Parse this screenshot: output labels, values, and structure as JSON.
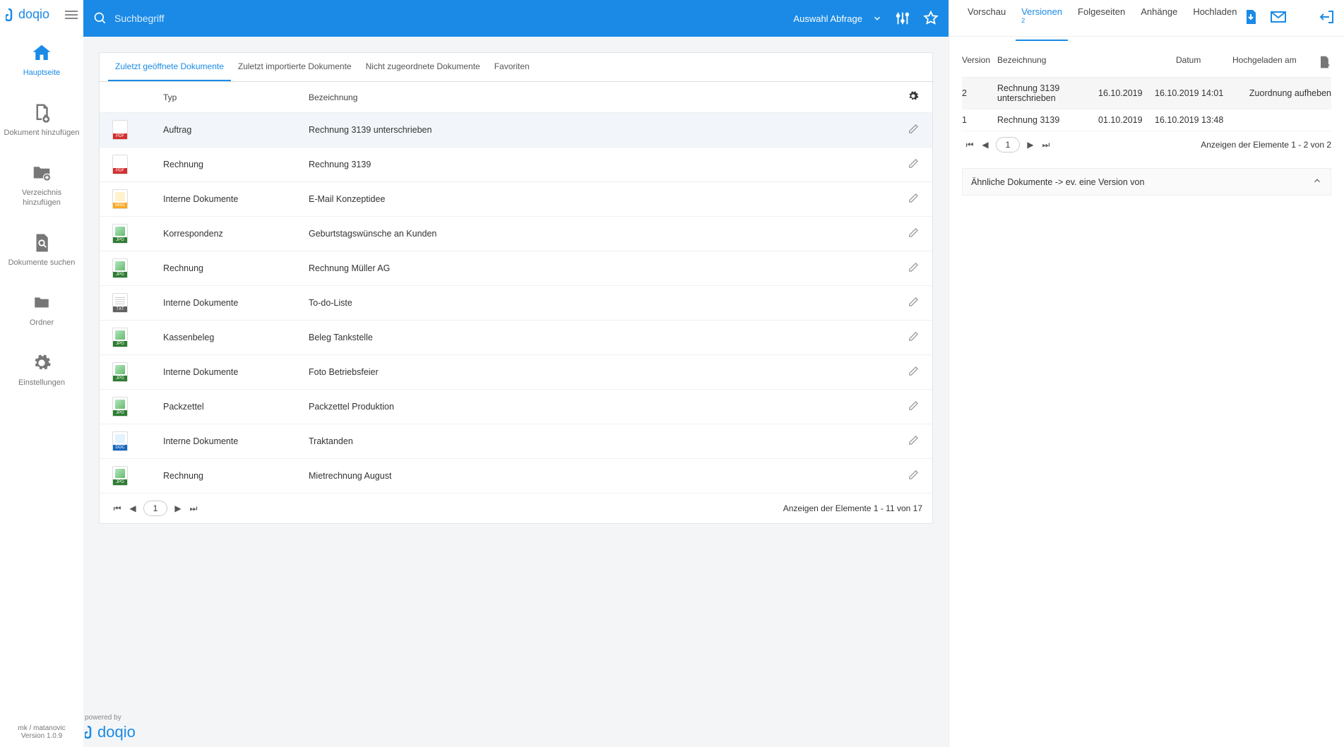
{
  "brand": "doqio",
  "sidebar": {
    "items": [
      {
        "label": "Hauptseite"
      },
      {
        "label": "Dokument hinzufügen"
      },
      {
        "label": "Verzeichnis hinzufügen"
      },
      {
        "label": "Dokumente suchen"
      },
      {
        "label": "Ordner"
      },
      {
        "label": "Einstellungen"
      }
    ],
    "footer_user": "mk / matanovic",
    "footer_version": "Version 1.0.9"
  },
  "search": {
    "placeholder": "Suchbegriff",
    "auswahl_label": "Auswahl Abfrage"
  },
  "doc_tabs": [
    "Zuletzt geöffnete Dokumente",
    "Zuletzt importierte Dokumente",
    "Nicht zugeordnete Dokumente",
    "Favoriten"
  ],
  "doc_table": {
    "head_type": "Typ",
    "head_name": "Bezeichnung",
    "rows": [
      {
        "ftype": "pdf",
        "type": "Auftrag",
        "name": "Rechnung 3139 unterschrieben"
      },
      {
        "ftype": "pdf",
        "type": "Rechnung",
        "name": "Rechnung 3139"
      },
      {
        "ftype": "msg",
        "type": "Interne Dokumente",
        "name": "E-Mail Konzeptidee"
      },
      {
        "ftype": "jpg",
        "type": "Korrespondenz",
        "name": "Geburtstagswünsche an Kunden"
      },
      {
        "ftype": "jpg",
        "type": "Rechnung",
        "name": "Rechnung Müller AG"
      },
      {
        "ftype": "txt",
        "type": "Interne Dokumente",
        "name": "To-do-Liste"
      },
      {
        "ftype": "jpg",
        "type": "Kassenbeleg",
        "name": "Beleg Tankstelle"
      },
      {
        "ftype": "jpg",
        "type": "Interne Dokumente",
        "name": "Foto Betriebsfeier"
      },
      {
        "ftype": "jpg",
        "type": "Packzettel",
        "name": "Packzettel Produktion"
      },
      {
        "ftype": "doc",
        "type": "Interne Dokumente",
        "name": "Traktanden"
      },
      {
        "ftype": "jpg",
        "type": "Rechnung",
        "name": "Mietrechnung August"
      }
    ],
    "pager_page": "1",
    "pager_info": "Anzeigen der Elemente 1 - 11 von 17"
  },
  "right": {
    "tabs": [
      "Vorschau",
      "Versionen",
      "Folgeseiten",
      "Anhänge",
      "Hochladen"
    ],
    "versions_badge": "2",
    "ver_head": {
      "v": "Version",
      "b": "Bezeichnung",
      "d": "Datum",
      "h": "Hochgeladen am"
    },
    "versions": [
      {
        "v": "2",
        "b": "Rechnung 3139 unterschrieben",
        "d": "16.10.2019",
        "h": "16.10.2019 14:01",
        "action": "Zuordnung aufheben"
      },
      {
        "v": "1",
        "b": "Rechnung 3139",
        "d": "01.10.2019",
        "h": "16.10.2019 13:48",
        "action": ""
      }
    ],
    "pager_page": "1",
    "pager_info": "Anzeigen der Elemente 1 - 2 von 2",
    "similar_label": "Ähnliche Dokumente -> ev. eine Version von"
  },
  "powered_by": "powered by"
}
